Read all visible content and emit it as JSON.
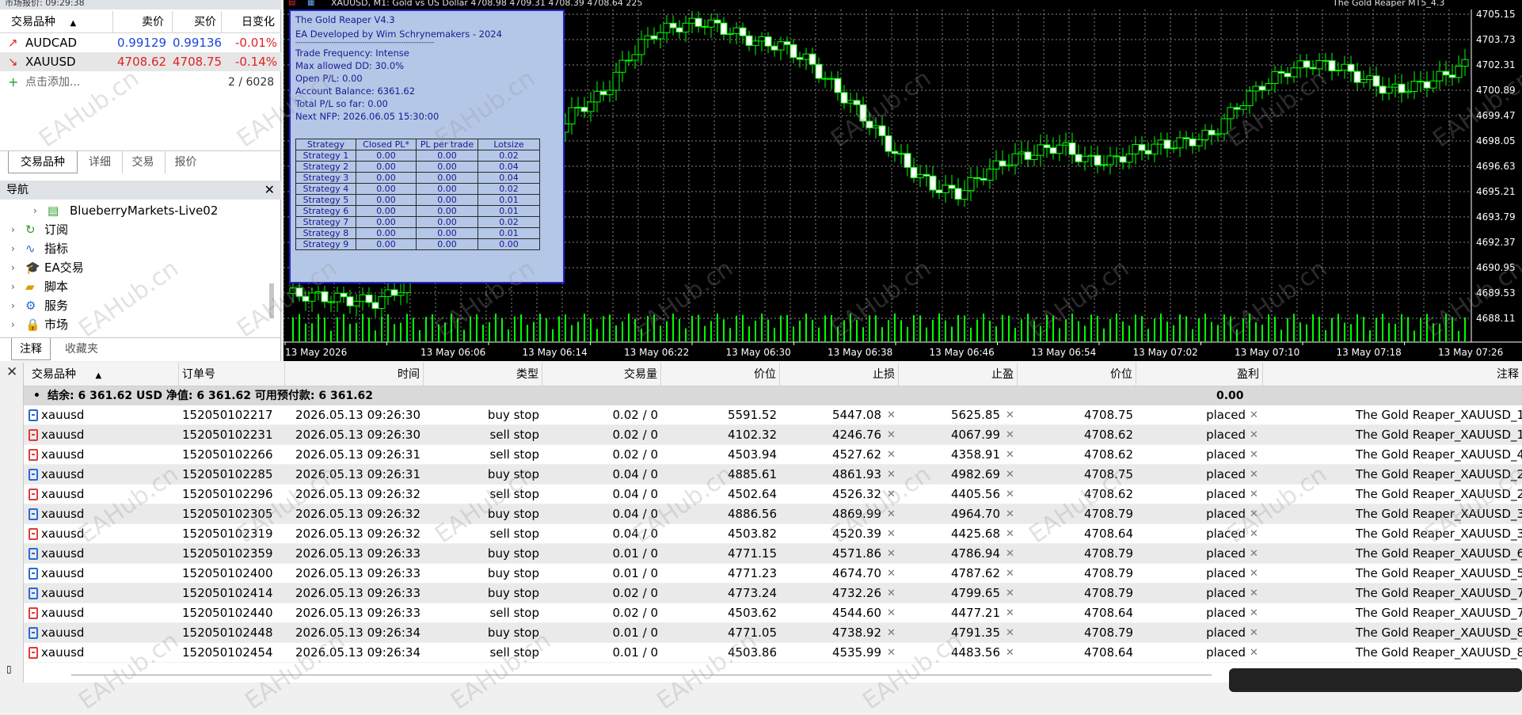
{
  "market_watch": {
    "title": "市场报价: 09:29:38",
    "columns": [
      "交易品种",
      "卖价",
      "买价",
      "日变化"
    ],
    "rows": [
      {
        "symbol": "AUDCAD",
        "bid": "0.99129",
        "ask": "0.99136",
        "change": "-0.01%",
        "arrow": "↗"
      },
      {
        "symbol": "XAUUSD",
        "bid": "4708.62",
        "ask": "4708.75",
        "change": "-0.14%",
        "arrow": "↘"
      }
    ],
    "add_label": "点击添加...",
    "count": "2 / 6028",
    "tabs": [
      "交易品种",
      "详细",
      "交易",
      "报价"
    ]
  },
  "navigator": {
    "title": "导航",
    "items": [
      {
        "label": "BlueberryMarkets-Live02",
        "icon": "server-icon"
      },
      {
        "label": "订阅",
        "icon": "subscription-icon"
      },
      {
        "label": "指标",
        "icon": "indicator-icon"
      },
      {
        "label": "EA交易",
        "icon": "expert-icon"
      },
      {
        "label": "脚本",
        "icon": "script-icon"
      },
      {
        "label": "服务",
        "icon": "service-icon"
      },
      {
        "label": "市场",
        "icon": "market-icon"
      }
    ],
    "tabs": [
      "注释",
      "收藏夹"
    ]
  },
  "chart": {
    "header": "XAUUSD, M1:  Gold vs US Dollar  4708.98 4709.31 4708.39 4708.64  225",
    "ea_name": "The Gold Reaper MT5_4.3",
    "price_labels": [
      "4705.15",
      "4703.73",
      "4702.31",
      "4700.89",
      "4699.47",
      "4698.05",
      "4696.63",
      "4695.21",
      "4693.79",
      "4692.37",
      "4690.95",
      "4689.53",
      "4688.11"
    ],
    "time_labels": [
      "13 May 2026",
      "13 May 06:06",
      "13 May 06:14",
      "13 May 06:22",
      "13 May 06:30",
      "13 May 06:38",
      "13 May 06:46",
      "13 May 06:54",
      "13 May 07:02",
      "13 May 07:10",
      "13 May 07:18",
      "13 May 07:26"
    ],
    "colors": {
      "bull": "#00ff00",
      "bear_fill": "#ffffff",
      "grid": "#8a8a8a",
      "volume": "#00ff00"
    }
  },
  "ea_panel": {
    "lines": [
      "The Gold Reaper V4.3",
      "EA Developed by Wim Schrynemakers - 2024",
      "------------------------------------------------------",
      "Trade Frequency: Intense",
      "Max allowed DD: 30.0%",
      "Open P/L: 0.00",
      "Account Balance: 6361.62",
      "Total P/L so far: 0.00",
      "Next NFP: 2026.06.05 15:30:00"
    ],
    "table_headers": [
      "Strategy",
      "Closed PL*",
      "PL per trade",
      "Lotsize"
    ],
    "table_rows": [
      [
        "Strategy 1",
        "0.00",
        "0.00",
        "0.02"
      ],
      [
        "Strategy 2",
        "0.00",
        "0.00",
        "0.04"
      ],
      [
        "Strategy 3",
        "0.00",
        "0.00",
        "0.04"
      ],
      [
        "Strategy 4",
        "0.00",
        "0.00",
        "0.02"
      ],
      [
        "Strategy 5",
        "0.00",
        "0.00",
        "0.01"
      ],
      [
        "Strategy 6",
        "0.00",
        "0.00",
        "0.01"
      ],
      [
        "Strategy 7",
        "0.00",
        "0.00",
        "0.02"
      ],
      [
        "Strategy 8",
        "0.00",
        "0.00",
        "0.01"
      ],
      [
        "Strategy 9",
        "0.00",
        "0.00",
        "0.00"
      ]
    ]
  },
  "orders": {
    "columns": [
      "交易品种",
      "订单号",
      "时间",
      "类型",
      "交易量",
      "价位",
      "止损",
      "止盈",
      "价位",
      "盈利",
      "注释"
    ],
    "summary": "结余: 6 361.62 USD  净值: 6 361.62  可用预付款: 6 361.62",
    "summary_profit": "0.00",
    "rows": [
      {
        "symbol": "xauusd",
        "ticket": "152050102217",
        "time": "2026.05.13 09:26:30",
        "type": "buy stop",
        "volume": "0.02 / 0",
        "price": "5591.52",
        "sl": "5447.08",
        "tp": "5625.85",
        "current": "4708.75",
        "profit": "placed",
        "comment": "The Gold Reaper_XAUUSD_1"
      },
      {
        "symbol": "xauusd",
        "ticket": "152050102231",
        "time": "2026.05.13 09:26:30",
        "type": "sell stop",
        "volume": "0.02 / 0",
        "price": "4102.32",
        "sl": "4246.76",
        "tp": "4067.99",
        "current": "4708.62",
        "profit": "placed",
        "comment": "The Gold Reaper_XAUUSD_1"
      },
      {
        "symbol": "xauusd",
        "ticket": "152050102266",
        "time": "2026.05.13 09:26:31",
        "type": "sell stop",
        "volume": "0.02 / 0",
        "price": "4503.94",
        "sl": "4527.62",
        "tp": "4358.91",
        "current": "4708.62",
        "profit": "placed",
        "comment": "The Gold Reaper_XAUUSD_4"
      },
      {
        "symbol": "xauusd",
        "ticket": "152050102285",
        "time": "2026.05.13 09:26:31",
        "type": "buy stop",
        "volume": "0.04 / 0",
        "price": "4885.61",
        "sl": "4861.93",
        "tp": "4982.69",
        "current": "4708.75",
        "profit": "placed",
        "comment": "The Gold Reaper_XAUUSD_2"
      },
      {
        "symbol": "xauusd",
        "ticket": "152050102296",
        "time": "2026.05.13 09:26:32",
        "type": "sell stop",
        "volume": "0.04 / 0",
        "price": "4502.64",
        "sl": "4526.32",
        "tp": "4405.56",
        "current": "4708.62",
        "profit": "placed",
        "comment": "The Gold Reaper_XAUUSD_2"
      },
      {
        "symbol": "xauusd",
        "ticket": "152050102305",
        "time": "2026.05.13 09:26:32",
        "type": "buy stop",
        "volume": "0.04 / 0",
        "price": "4886.56",
        "sl": "4869.99",
        "tp": "4964.70",
        "current": "4708.79",
        "profit": "placed",
        "comment": "The Gold Reaper_XAUUSD_3"
      },
      {
        "symbol": "xauusd",
        "ticket": "152050102319",
        "time": "2026.05.13 09:26:32",
        "type": "sell stop",
        "volume": "0.04 / 0",
        "price": "4503.82",
        "sl": "4520.39",
        "tp": "4425.68",
        "current": "4708.64",
        "profit": "placed",
        "comment": "The Gold Reaper_XAUUSD_3"
      },
      {
        "symbol": "xauusd",
        "ticket": "152050102359",
        "time": "2026.05.13 09:26:33",
        "type": "buy stop",
        "volume": "0.01 / 0",
        "price": "4771.15",
        "sl": "4571.86",
        "tp": "4786.94",
        "current": "4708.79",
        "profit": "placed",
        "comment": "The Gold Reaper_XAUUSD_6"
      },
      {
        "symbol": "xauusd",
        "ticket": "152050102400",
        "time": "2026.05.13 09:26:33",
        "type": "buy stop",
        "volume": "0.01 / 0",
        "price": "4771.23",
        "sl": "4674.70",
        "tp": "4787.62",
        "current": "4708.79",
        "profit": "placed",
        "comment": "The Gold Reaper_XAUUSD_5"
      },
      {
        "symbol": "xauusd",
        "ticket": "152050102414",
        "time": "2026.05.13 09:26:33",
        "type": "buy stop",
        "volume": "0.02 / 0",
        "price": "4773.24",
        "sl": "4732.26",
        "tp": "4799.65",
        "current": "4708.79",
        "profit": "placed",
        "comment": "The Gold Reaper_XAUUSD_7"
      },
      {
        "symbol": "xauusd",
        "ticket": "152050102440",
        "time": "2026.05.13 09:26:33",
        "type": "sell stop",
        "volume": "0.02 / 0",
        "price": "4503.62",
        "sl": "4544.60",
        "tp": "4477.21",
        "current": "4708.64",
        "profit": "placed",
        "comment": "The Gold Reaper_XAUUSD_7"
      },
      {
        "symbol": "xauusd",
        "ticket": "152050102448",
        "time": "2026.05.13 09:26:34",
        "type": "buy stop",
        "volume": "0.01 / 0",
        "price": "4771.05",
        "sl": "4738.92",
        "tp": "4791.35",
        "current": "4708.79",
        "profit": "placed",
        "comment": "The Gold Reaper_XAUUSD_8"
      },
      {
        "symbol": "xauusd",
        "ticket": "152050102454",
        "time": "2026.05.13 09:26:34",
        "type": "sell stop",
        "volume": "0.01 / 0",
        "price": "4503.86",
        "sl": "4535.99",
        "tp": "4483.56",
        "current": "4708.64",
        "profit": "placed",
        "comment": "The Gold Reaper_XAUUSD_8"
      }
    ]
  },
  "watermark": "EAHub.cn"
}
